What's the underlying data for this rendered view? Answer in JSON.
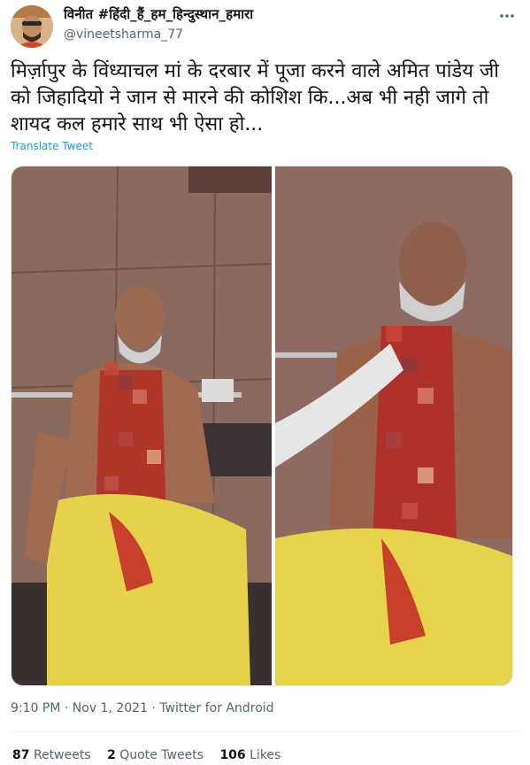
{
  "user": {
    "display_name": "विनीत #हिंदी_हैं_हम_हिन्दुस्थान_हमारा",
    "handle": "@vineetsharma_77",
    "avatar_icon": "profile-avatar"
  },
  "tweet": {
    "text": "मिर्ज़ापुर के विंध्याचल मां के दरबार में पूजा करने वाले अमित पांडेय जी को जिहादियो ने जान से मारने की कोशिश कि...अब भी नही जागे तो शायद कल हमारे साथ भी ऐसा हो...",
    "translate_label": "Translate Tweet",
    "more_icon": "more-options-icon"
  },
  "media": {
    "images": [
      {
        "name": "photo-left"
      },
      {
        "name": "photo-right"
      }
    ]
  },
  "meta": {
    "time": "9:10 PM",
    "separator": "·",
    "date": "Nov 1, 2021",
    "source": "Twitter for Android"
  },
  "stats": {
    "retweets_count": "87",
    "retweets_label": "Retweets",
    "quotes_count": "2",
    "quotes_label": "Quote Tweets",
    "likes_count": "106",
    "likes_label": "Likes"
  },
  "colors": {
    "link": "#1d9bf0",
    "secondary_text": "#536471",
    "primary_text": "#0f1419"
  }
}
